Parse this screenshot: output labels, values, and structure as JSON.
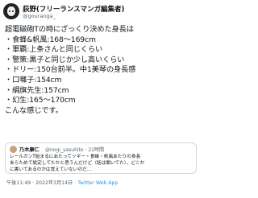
{
  "tweet": {
    "author_name": "荻野(フリーランスマンガ編集者)",
    "author_handle": "@gouranga_",
    "body_lines": [
      "超電磁砲Tの時にざっくり決めた身長は",
      "・食蜂&帆風:168〜169cm",
      "・軍覇:上条さんと同じくらい",
      "・警策:黒子と同じか少し高いくらい",
      "・ドリー:150台前半。中1美琴の身長感",
      "・口囃子:154cm",
      "・絹旗先生:157cm",
      "・幻生:165〜170cm",
      "こんな感じです。"
    ],
    "quoted": {
      "author_name": "乃木康仁",
      "author_handle": "@nogi_yasuhito · 21時間",
      "text_lines": [
        "レールガンT始まるにあたってソギー・食蜂・帆風あたりの身長",
        "あらためて設定してたかと思うんだけど（話は聞いてた）、どこか",
        "に書いてあるのかは覚えていないのだ…"
      ]
    },
    "time": "午後11:49 · 2022年3月14日 · ",
    "client": "Twitter Web App"
  }
}
